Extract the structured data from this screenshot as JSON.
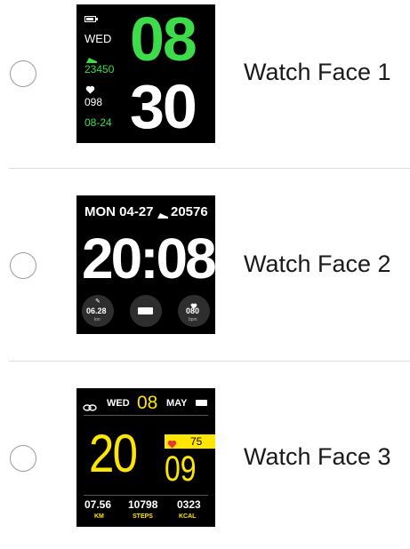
{
  "options": [
    {
      "label": "Watch Face 1",
      "watch": {
        "day": "WED",
        "steps": "23450",
        "heart_rate": "098",
        "date": "08-24",
        "hour": "08",
        "minute": "30"
      }
    },
    {
      "label": "Watch Face 2",
      "watch": {
        "date_line": "MON 04-27",
        "steps": "20576",
        "time": "20:08",
        "distance": "06.28",
        "distance_unit": "km",
        "heart_rate": "080",
        "heart_unit": "bpm"
      }
    },
    {
      "label": "Watch Face 3",
      "watch": {
        "weekday": "WED",
        "day": "08",
        "month": "MAY",
        "hour": "20",
        "minute": "09",
        "heart_rate": "75",
        "stats": [
          {
            "value": "07.56",
            "unit": "KM"
          },
          {
            "value": "10798",
            "unit": "STEPS"
          },
          {
            "value": "0323",
            "unit": "KCAL"
          }
        ]
      }
    }
  ],
  "colors": {
    "face1_green": "#3ddc4a",
    "face3_yellow": "#ffe600",
    "heart_red": "#e53935"
  }
}
